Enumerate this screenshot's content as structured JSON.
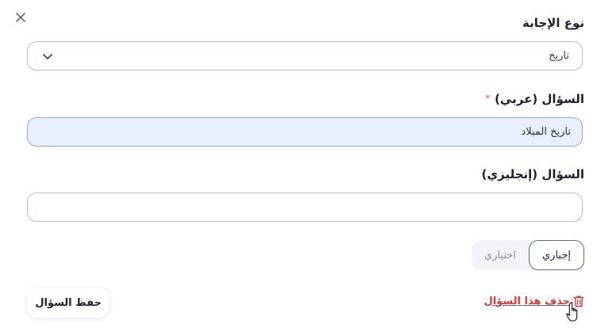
{
  "answer_type": {
    "label": "نوع الإجابة",
    "selected": "تاريخ"
  },
  "question_arabic": {
    "label": "السؤال (عربي)",
    "required_mark": "*",
    "value": "تاريخ الميلاد"
  },
  "question_english": {
    "label": "السؤال (إنجليزي)",
    "value": ""
  },
  "requirement_toggle": {
    "options": [
      "إجباري",
      "اختياري"
    ],
    "selected": "إجباري"
  },
  "actions": {
    "delete_label": "حذف هذا السؤال",
    "save_label": "حفظ السؤال"
  },
  "colors": {
    "accent": "#5b6a8f",
    "danger": "#d23b3b",
    "filled_bg": "#e8effd"
  }
}
